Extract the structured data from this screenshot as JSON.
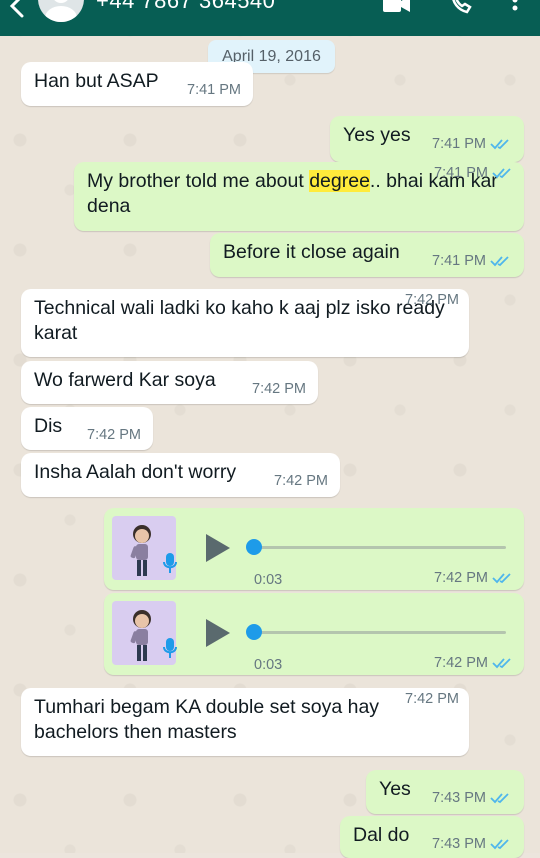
{
  "header": {
    "contact": "+44 7867 364540",
    "icons": [
      "back-arrow-icon",
      "avatar",
      "video-call-icon",
      "voice-call-icon",
      "menu-dots-icon"
    ]
  },
  "date_chip": "April 19, 2016",
  "messages": [
    {
      "dir": "in",
      "text": "Han but ASAP",
      "time": "7:41 PM"
    },
    {
      "dir": "out",
      "text": "Yes yes",
      "time": "7:41 PM",
      "ticks": "read"
    },
    {
      "dir": "out",
      "text_before": "My brother told me about ",
      "highlight": "degree",
      "text_after": ".. bhai kam kar dena",
      "time": "7:41 PM",
      "ticks": "read"
    },
    {
      "dir": "out",
      "text": "Before it close again",
      "time": "7:41 PM",
      "ticks": "read"
    },
    {
      "dir": "in",
      "text": "Technical wali ladki ko kaho k aaj plz isko ready karat",
      "time": "7:42 PM"
    },
    {
      "dir": "in",
      "text": "Wo farwerd Kar soya",
      "time": "7:42 PM"
    },
    {
      "dir": "in",
      "text": "Dis",
      "time": "7:42 PM"
    },
    {
      "dir": "in",
      "text": "Insha Aalah don't worry",
      "time": "7:42 PM"
    },
    {
      "dir": "out",
      "type": "voice",
      "duration": "0:03",
      "time": "7:42 PM",
      "ticks": "read",
      "progress": 0
    },
    {
      "dir": "out",
      "type": "voice",
      "duration": "0:03",
      "time": "7:42 PM",
      "ticks": "read",
      "progress": 0
    },
    {
      "dir": "in",
      "text": "Tumhari begam KA double set soya hay bachelors then masters",
      "time": "7:42 PM"
    },
    {
      "dir": "out",
      "text": "Yes",
      "time": "7:43 PM",
      "ticks": "read"
    },
    {
      "dir": "out",
      "text": "Dal do",
      "time": "7:43 PM",
      "ticks": "read"
    }
  ],
  "colors": {
    "header": "#075e54",
    "incoming": "#ffffff",
    "outgoing": "#dcf8c6",
    "read_ticks": "#4fb6ec",
    "highlight": "#ffeb3b",
    "voice_knob": "#1e9be9"
  }
}
